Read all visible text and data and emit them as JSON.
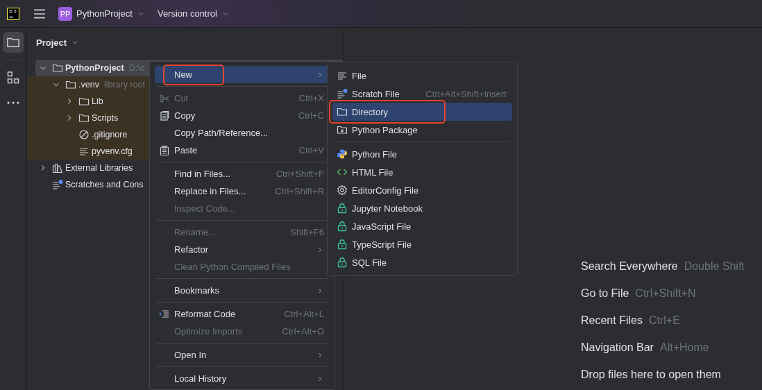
{
  "title_bar": {
    "project_badge": "PP",
    "project_name": "PythonProject",
    "vcs_menu": "Version control"
  },
  "tool_strip": [
    {
      "selected": true
    },
    {
      "selected": false
    },
    {
      "selected": false
    }
  ],
  "project_panel": {
    "title": "Project",
    "tree": [
      {
        "label": "PythonProject",
        "hint": "D:\\c",
        "expanded": true,
        "selected": true,
        "bold": true,
        "children": [
          {
            "label": ".venv",
            "hint": "library root",
            "expanded": true,
            "selected": false,
            "library_root": true,
            "children": [
              {
                "label": "Lib",
                "expanded": false,
                "selected": false
              },
              {
                "label": "Scripts",
                "expanded": false,
                "selected": false
              },
              {
                "label": ".gitignore",
                "selected": false
              },
              {
                "label": "pyvenv.cfg",
                "selected": false
              }
            ]
          }
        ]
      },
      {
        "label": "External Libraries",
        "expanded": false,
        "selected": false
      },
      {
        "label": "Scratches and Cons",
        "selected": false
      }
    ]
  },
  "context_menu": {
    "items": [
      {
        "kind": "item",
        "label": "New",
        "submenu": true,
        "selected": true,
        "disabled": false,
        "marked": true
      },
      {
        "kind": "separator"
      },
      {
        "kind": "item",
        "label": "Cut",
        "shortcut": "Ctrl+X",
        "selected": false,
        "disabled": true
      },
      {
        "kind": "item",
        "label": "Copy",
        "shortcut": "Ctrl+C",
        "selected": false,
        "disabled": false
      },
      {
        "kind": "item",
        "label": "Copy Path/Reference...",
        "selected": false,
        "disabled": false
      },
      {
        "kind": "item",
        "label": "Paste",
        "shortcut": "Ctrl+V",
        "selected": false,
        "disabled": false
      },
      {
        "kind": "separator"
      },
      {
        "kind": "item",
        "label": "Find in Files...",
        "shortcut": "Ctrl+Shift+F",
        "selected": false,
        "disabled": false
      },
      {
        "kind": "item",
        "label": "Replace in Files...",
        "shortcut": "Ctrl+Shift+R",
        "selected": false,
        "disabled": false
      },
      {
        "kind": "item",
        "label": "Inspect Code...",
        "selected": false,
        "disabled": true
      },
      {
        "kind": "separator"
      },
      {
        "kind": "item",
        "label": "Rename...",
        "shortcut": "Shift+F6",
        "selected": false,
        "disabled": true
      },
      {
        "kind": "item",
        "label": "Refactor",
        "submenu": true,
        "selected": false,
        "disabled": false
      },
      {
        "kind": "item",
        "label": "Clean Python Compiled Files",
        "selected": false,
        "disabled": true
      },
      {
        "kind": "separator"
      },
      {
        "kind": "item",
        "label": "Bookmarks",
        "submenu": true,
        "selected": false,
        "disabled": false
      },
      {
        "kind": "separator"
      },
      {
        "kind": "item",
        "label": "Reformat Code",
        "shortcut": "Ctrl+Alt+L",
        "selected": false,
        "disabled": false
      },
      {
        "kind": "item",
        "label": "Optimize Imports",
        "shortcut": "Ctrl+Alt+O",
        "selected": false,
        "disabled": true
      },
      {
        "kind": "separator"
      },
      {
        "kind": "item",
        "label": "Open In",
        "submenu": true,
        "selected": false,
        "disabled": false
      },
      {
        "kind": "separator"
      },
      {
        "kind": "item",
        "label": "Local History",
        "submenu": true,
        "selected": false,
        "disabled": false
      }
    ]
  },
  "new_submenu": {
    "items": [
      {
        "kind": "item",
        "label": "File",
        "selected": false
      },
      {
        "kind": "item",
        "label": "Scratch File",
        "shortcut": "Ctrl+Alt+Shift+Insert",
        "selected": false
      },
      {
        "kind": "item",
        "label": "Directory",
        "selected": true,
        "marked": true
      },
      {
        "kind": "item",
        "label": "Python Package",
        "selected": false
      },
      {
        "kind": "separator"
      },
      {
        "kind": "item",
        "label": "Python File",
        "selected": false
      },
      {
        "kind": "item",
        "label": "HTML File",
        "selected": false
      },
      {
        "kind": "item",
        "label": "EditorConfig File",
        "selected": false
      },
      {
        "kind": "item",
        "label": "Jupyter Notebook",
        "selected": false
      },
      {
        "kind": "item",
        "label": "JavaScript File",
        "selected": false
      },
      {
        "kind": "item",
        "label": "TypeScript File",
        "selected": false
      },
      {
        "kind": "item",
        "label": "SQL File",
        "selected": false
      }
    ]
  },
  "editor_hints": [
    {
      "action": "Search Everywhere",
      "shortcut": "Double Shift"
    },
    {
      "action": "Go to File",
      "shortcut": "Ctrl+Shift+N"
    },
    {
      "action": "Recent Files",
      "shortcut": "Ctrl+E"
    },
    {
      "action": "Navigation Bar",
      "shortcut": "Alt+Home"
    },
    {
      "action": "Drop files here to open them"
    }
  ]
}
